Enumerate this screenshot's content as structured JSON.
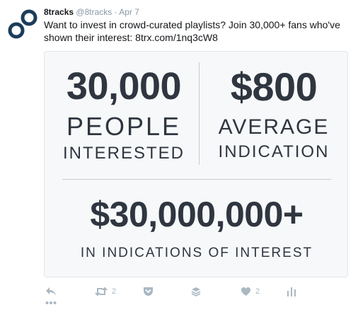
{
  "tweet": {
    "author_name": "8tracks",
    "author_handle": "@8tracks",
    "separator": "·",
    "date": "Apr 7",
    "text": "Want to invest in crowd-curated playlists? Join 30,000+ fans who've shown their interest: 8trx.com/1nq3cW8"
  },
  "card": {
    "stat1": {
      "number": "30,000",
      "line1": "PEOPLE",
      "line2": "INTERESTED"
    },
    "stat2": {
      "number": "$800",
      "line1": "AVERAGE",
      "line2": "INDICATION"
    },
    "stat3": {
      "number": "$30,000,000+",
      "line1": "IN INDICATIONS OF INTEREST"
    }
  },
  "actions": {
    "retweet_count": "2",
    "like_count": "2",
    "icons": [
      "reply-icon",
      "retweet-icon",
      "pocket-icon",
      "buffer-icon",
      "heart-icon",
      "analytics-icon",
      "more-icon"
    ]
  },
  "colors": {
    "text": "#14171a",
    "muted": "#8899a6",
    "icon": "#aab8c2",
    "card_text": "#2f3640",
    "logo": "#1c3d5a"
  }
}
